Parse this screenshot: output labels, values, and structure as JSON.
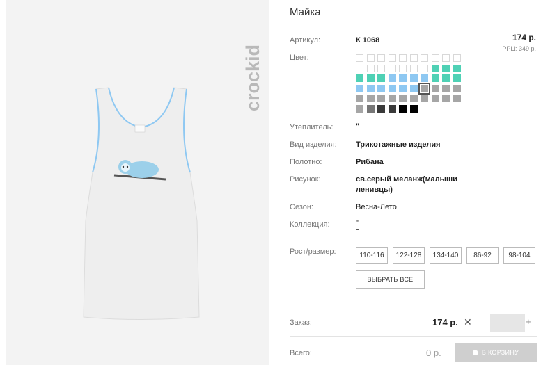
{
  "product": {
    "title": "Майка",
    "brand": "crockid",
    "article_label": "Артикул:",
    "article_value": "К 1068",
    "price": "174 р.",
    "rrp": "РРЦ: 349 р.",
    "color_label": "Цвет:"
  },
  "attributes": [
    {
      "label": "Утеплитель:",
      "value": "\""
    },
    {
      "label": "Вид изделия:",
      "value": "Трикотажные изделия"
    },
    {
      "label": "Полотно:",
      "value": "Рибана"
    },
    {
      "label": "Рисунок:",
      "value": "св.серый меланж(малыши ленивцы)"
    },
    {
      "label": "Сезон:",
      "value": "Весна-Лето"
    },
    {
      "label": "Коллекция:",
      "value": "\""
    }
  ],
  "sizes": {
    "label": "Рост/размер:",
    "options": [
      "110-116",
      "122-128",
      "134-140",
      "86-92",
      "98-104"
    ],
    "select_all": "ВЫБРАТЬ ВСЕ"
  },
  "order": {
    "label": "Заказ:",
    "price": "174 р.",
    "times": "✕",
    "minus": "–",
    "plus": "+",
    "quantity": "",
    "total_label": "Всего:",
    "total_value": "0 р.",
    "cart_button": "В КОРЗИНУ"
  },
  "colors": {
    "teal": "#4fd1b5",
    "blue": "#8ec8f2",
    "gray": "#a6a6a6",
    "dark": "#3a3a3a",
    "empty_border": "#d8d8d8"
  }
}
